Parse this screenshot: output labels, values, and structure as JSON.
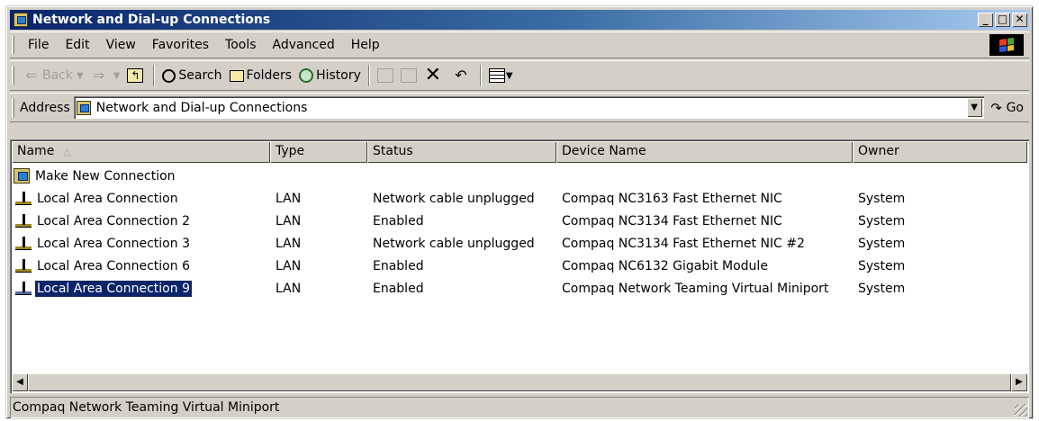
{
  "window": {
    "title": "Network and Dial-up Connections",
    "caption_minimize": "_",
    "caption_maximize": "□",
    "caption_close": "✕"
  },
  "menubar": {
    "items": [
      "File",
      "Edit",
      "View",
      "Favorites",
      "Tools",
      "Advanced",
      "Help"
    ]
  },
  "toolbar": {
    "back_label": "Back",
    "search_label": "Search",
    "folders_label": "Folders",
    "history_label": "History",
    "icons": [
      "back-arrow-icon",
      "forward-arrow-icon",
      "up-folder-icon",
      "search-icon",
      "folders-icon",
      "history-icon",
      "move-to-icon",
      "copy-to-icon",
      "delete-icon",
      "undo-icon",
      "views-icon"
    ]
  },
  "address": {
    "label": "Address",
    "value": "Network and Dial-up Connections",
    "go_label": "Go"
  },
  "list": {
    "columns": [
      "Name",
      "Type",
      "Status",
      "Device Name",
      "Owner"
    ],
    "rows": [
      {
        "name": "Make New Connection",
        "type": "",
        "status": "",
        "device": "",
        "owner": "",
        "icon": "new-connection-icon",
        "selected": false
      },
      {
        "name": "Local Area Connection",
        "type": "LAN",
        "status": "Network cable unplugged",
        "device": "Compaq NC3163 Fast Ethernet NIC",
        "owner": "System",
        "icon": "lan-connection-icon",
        "selected": false
      },
      {
        "name": "Local Area Connection 2",
        "type": "LAN",
        "status": "Enabled",
        "device": "Compaq NC3134 Fast Ethernet NIC",
        "owner": "System",
        "icon": "lan-connection-icon",
        "selected": false
      },
      {
        "name": "Local Area Connection 3",
        "type": "LAN",
        "status": "Network cable unplugged",
        "device": "Compaq NC3134 Fast Ethernet NIC #2",
        "owner": "System",
        "icon": "lan-connection-icon",
        "selected": false
      },
      {
        "name": "Local Area Connection 6",
        "type": "LAN",
        "status": "Enabled",
        "device": "Compaq NC6132 Gigabit Module",
        "owner": "System",
        "icon": "lan-connection-icon",
        "selected": false
      },
      {
        "name": "Local Area Connection 9",
        "type": "LAN",
        "status": "Enabled",
        "device": "Compaq Network Teaming Virtual Miniport",
        "owner": "System",
        "icon": "lan-connection-icon",
        "selected": true
      }
    ]
  },
  "statusbar": {
    "text": "Compaq Network Teaming Virtual Miniport"
  },
  "colors": {
    "title_gradient_start": "#0a246a",
    "title_gradient_end": "#a6caf0",
    "selection": "#0a246a",
    "face": "#d4d0c8"
  }
}
